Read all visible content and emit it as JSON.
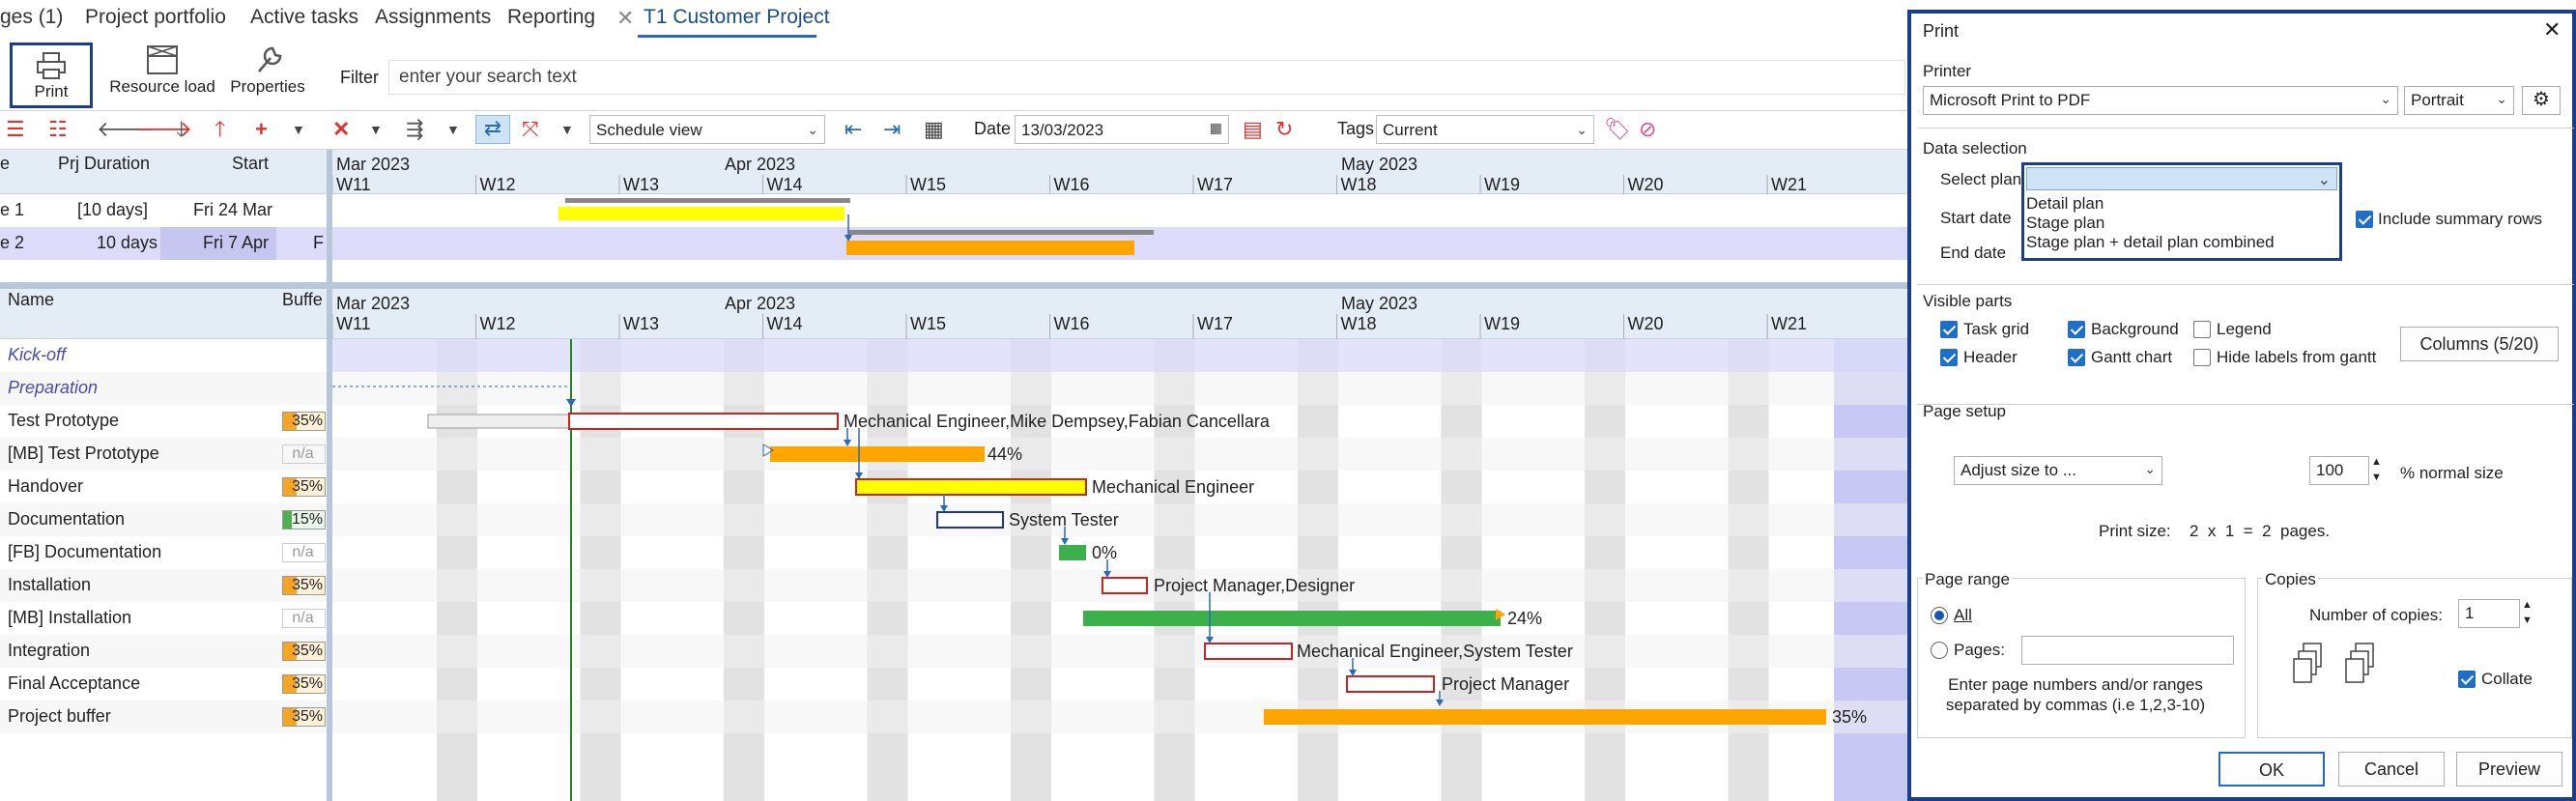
{
  "tabs": [
    "ges (1)",
    "Project portfolio",
    "Active tasks",
    "Assignments",
    "Reporting",
    "T1 Customer Project"
  ],
  "ribbon": {
    "print": "Print",
    "resource_load": "Resource load",
    "properties": "Properties",
    "filter_label": "Filter",
    "search_placeholder": "enter your search text"
  },
  "toolbar": {
    "view": "Schedule view",
    "date_label": "Date",
    "date_value": "13/03/2023",
    "tags_label": "Tags",
    "tags_value": "Current"
  },
  "upper": {
    "headers": {
      "col1": "e",
      "duration": "Prj Duration",
      "start": "Start"
    },
    "rows": [
      {
        "name": "e 1",
        "duration": "[10 days]",
        "start": "Fri 24 Mar"
      },
      {
        "name": "e 2",
        "duration": "10 days",
        "start": "Fri 7 Apr",
        "extra": "F"
      }
    ]
  },
  "timeline": {
    "months": [
      "Mar 2023",
      "Apr 2023",
      "May 2023"
    ],
    "weeks": [
      "W11",
      "W12",
      "W13",
      "W14",
      "W15",
      "W16",
      "W17",
      "W18",
      "W19",
      "W20",
      "W21"
    ]
  },
  "lower": {
    "headers": {
      "name": "Name",
      "buffer": "Buffe"
    },
    "rows": [
      {
        "name": "Kick-off",
        "buffer": ""
      },
      {
        "name": "Preparation",
        "buffer": ""
      },
      {
        "name": "Test Prototype",
        "buffer": "35%"
      },
      {
        "name": "[MB]  Test Prototype",
        "buffer": "n/a"
      },
      {
        "name": "Handover",
        "buffer": "35%"
      },
      {
        "name": "Documentation",
        "buffer": "15%"
      },
      {
        "name": "[FB]  Documentation",
        "buffer": "n/a"
      },
      {
        "name": "Installation",
        "buffer": "35%"
      },
      {
        "name": "[MB]  Installation",
        "buffer": "n/a"
      },
      {
        "name": "Integration",
        "buffer": "35%"
      },
      {
        "name": "Final Acceptance",
        "buffer": "35%"
      },
      {
        "name": "Project buffer",
        "buffer": "35%"
      }
    ],
    "bar_labels": {
      "test_prototype": "Mechanical Engineer,Mike Dempsey,Fabian Cancellara",
      "mb_test_prototype": "44%",
      "handover": "Mechanical Engineer",
      "documentation": "System Tester",
      "fb_documentation": "0%",
      "installation": "Project Manager,Designer",
      "mb_installation": "24%",
      "integration": "Mechanical Engineer,System Tester",
      "final_acceptance": "Project Manager",
      "project_buffer": "35%"
    }
  },
  "dialog": {
    "title": "Print",
    "printer_group": "Printer",
    "printer": "Microsoft Print to PDF",
    "orientation": "Portrait",
    "data_selection": "Data selection",
    "select_plan": "Select plan",
    "plan_options": [
      "Detail plan",
      "Stage plan",
      "Stage plan + detail plan combined"
    ],
    "start_date": "Start date",
    "end_date": "End date",
    "include_summary": "Include summary rows",
    "visible_parts": "Visible parts",
    "task_grid": "Task grid",
    "background": "Background",
    "legend": "Legend",
    "columns_button": "Columns (5/20)",
    "header": "Header",
    "gantt_chart": "Gantt chart",
    "hide_labels": "Hide labels from gantt",
    "page_setup": "Page setup",
    "adjust": "Adjust size to ...",
    "percent": "100",
    "normal_size": "% normal size",
    "print_size_label": "Print size:",
    "print_size": "2  x  1  =  2  pages.",
    "page_range": "Page range",
    "all": "All",
    "pages": "Pages:",
    "pages_hint": "Enter page numbers and/or ranges separated by commas (i.e 1,2,3-10)",
    "copies": "Copies",
    "number_of_copies": "Number of copies:",
    "copies_value": "1",
    "collate": "Collate",
    "ok": "OK",
    "cancel": "Cancel",
    "preview": "Preview"
  }
}
